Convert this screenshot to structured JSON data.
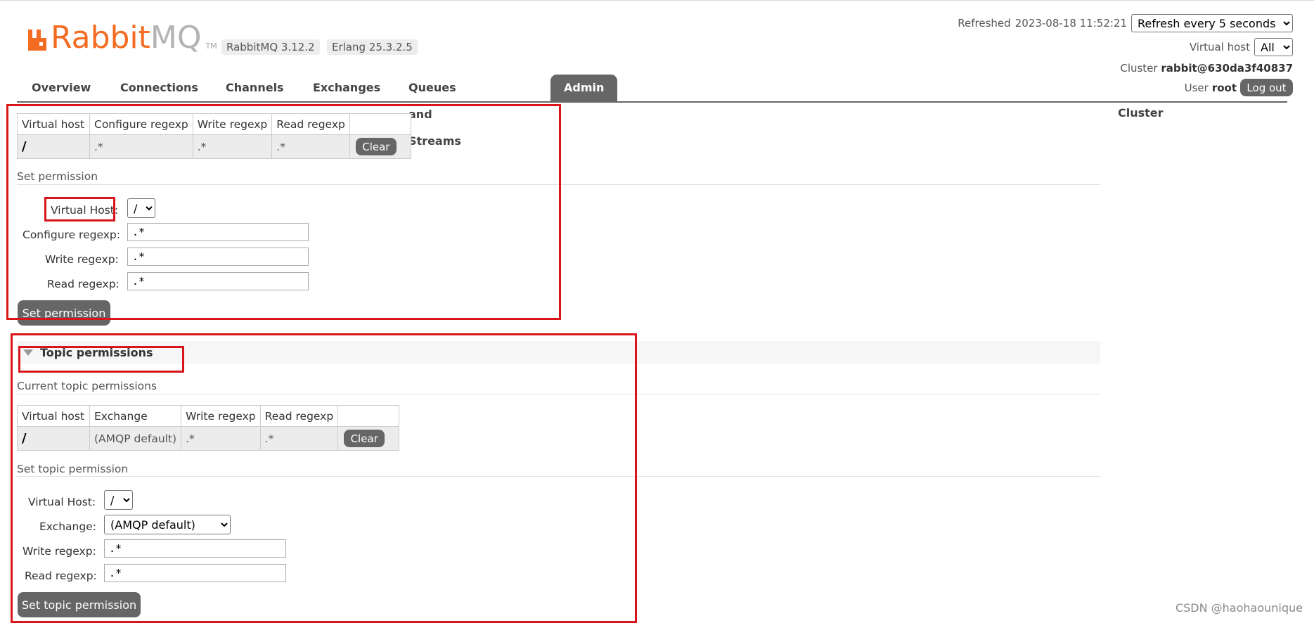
{
  "header": {
    "logo": {
      "text_main": "Rabbit",
      "text_mq": "MQ",
      "tm": "TM"
    },
    "versions": [
      "RabbitMQ 3.12.2",
      "Erlang 25.3.2.5"
    ],
    "refreshed_label": "Refreshed",
    "refreshed_time": "2023-08-18 11:52:21",
    "refresh_select": "Refresh every 5 seconds",
    "virtual_host_label": "Virtual host",
    "virtual_host_select": "All",
    "cluster_label": "Cluster",
    "cluster_name": "rabbit@630da3f40837",
    "user_label": "User",
    "user_name": "root",
    "logout_label": "Log out"
  },
  "tabs": [
    {
      "label": "Overview",
      "active": false
    },
    {
      "label": "Connections",
      "active": false
    },
    {
      "label": "Channels",
      "active": false
    },
    {
      "label": "Exchanges",
      "active": false
    },
    {
      "label": "Queues and Streams",
      "active": false
    },
    {
      "label": "Admin",
      "active": true
    }
  ],
  "sidebar": {
    "cluster": "Cluster"
  },
  "permissions": {
    "table": {
      "headers": [
        "Virtual host",
        "Configure regexp",
        "Write regexp",
        "Read regexp",
        ""
      ],
      "rows": [
        {
          "vhost": "/",
          "configure": ".*",
          "write": ".*",
          "read": ".*",
          "action": "Clear"
        }
      ]
    },
    "set_heading": "Set permission",
    "form": {
      "vhost_label": "Virtual Host:",
      "vhost_value": "/",
      "configure_label": "Configure regexp:",
      "configure_value": ".*",
      "write_label": "Write regexp:",
      "write_value": ".*",
      "read_label": "Read regexp:",
      "read_value": ".*",
      "submit": "Set permission"
    }
  },
  "topic_permissions": {
    "section_title": "Topic permissions",
    "current_heading": "Current topic permissions",
    "table": {
      "headers": [
        "Virtual host",
        "Exchange",
        "Write regexp",
        "Read regexp",
        ""
      ],
      "rows": [
        {
          "vhost": "/",
          "exchange": "(AMQP default)",
          "write": ".*",
          "read": ".*",
          "action": "Clear"
        }
      ]
    },
    "set_heading": "Set topic permission",
    "form": {
      "vhost_label": "Virtual Host:",
      "vhost_value": "/",
      "exchange_label": "Exchange:",
      "exchange_value": "(AMQP default)",
      "write_label": "Write regexp:",
      "write_value": ".*",
      "read_label": "Read regexp:",
      "read_value": ".*",
      "submit": "Set topic permission"
    }
  },
  "watermark": "CSDN @haohaounique",
  "colors": {
    "brand_orange": "#f46c22",
    "tab_active": "#666666",
    "highlight_red": "#d9151b"
  }
}
